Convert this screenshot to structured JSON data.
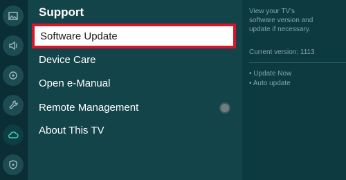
{
  "sidebar": {
    "items": [
      {
        "icon": "picture-icon"
      },
      {
        "icon": "sound-icon"
      },
      {
        "icon": "broadcast-icon"
      },
      {
        "icon": "wrench-icon"
      },
      {
        "icon": "cloud-support-icon"
      },
      {
        "icon": "shield-icon"
      }
    ]
  },
  "menu": {
    "title": "Support",
    "items": [
      {
        "label": "Software Update",
        "selected": true
      },
      {
        "label": "Device Care"
      },
      {
        "label": "Open e-Manual"
      },
      {
        "label": "Remote Management"
      },
      {
        "label": "About This TV"
      }
    ]
  },
  "panel": {
    "description_line1": "View your TV's",
    "description_line2": "software version and",
    "description_line3": "update if necessary.",
    "current_version": "Current version: 1113",
    "options": [
      "• Update Now",
      "• Auto update"
    ]
  },
  "colors": {
    "accent": "#d6152a",
    "background": "#0d3a40",
    "menu_bg": "#12444a"
  }
}
